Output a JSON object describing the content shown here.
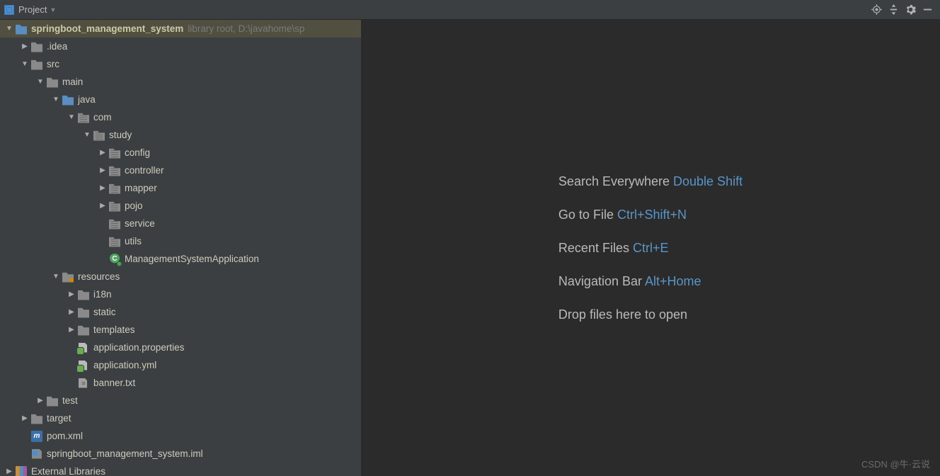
{
  "toolbar": {
    "title": "Project"
  },
  "tree": [
    {
      "indent": 0,
      "arrow": "Expanded",
      "icon": "folder-blue",
      "label": "springboot_management_system",
      "bold": true,
      "suffix": "library root,  D:\\javahome\\sp",
      "selected": true
    },
    {
      "indent": 1,
      "arrow": "Collapsed",
      "icon": "folder",
      "label": ".idea"
    },
    {
      "indent": 1,
      "arrow": "Expanded",
      "icon": "folder",
      "label": "src"
    },
    {
      "indent": 2,
      "arrow": "Expanded",
      "icon": "folder",
      "label": "main"
    },
    {
      "indent": 3,
      "arrow": "Expanded",
      "icon": "folder-blue",
      "label": "java"
    },
    {
      "indent": 4,
      "arrow": "Expanded",
      "icon": "pkg",
      "label": "com"
    },
    {
      "indent": 5,
      "arrow": "Expanded",
      "icon": "pkg",
      "label": "study"
    },
    {
      "indent": 6,
      "arrow": "Collapsed",
      "icon": "pkg",
      "label": "config"
    },
    {
      "indent": 6,
      "arrow": "Collapsed",
      "icon": "pkg",
      "label": "controller"
    },
    {
      "indent": 6,
      "arrow": "Collapsed",
      "icon": "pkg",
      "label": "mapper"
    },
    {
      "indent": 6,
      "arrow": "Collapsed",
      "icon": "pkg",
      "label": "pojo"
    },
    {
      "indent": 6,
      "arrow": "None",
      "icon": "pkg",
      "label": "service"
    },
    {
      "indent": 6,
      "arrow": "None",
      "icon": "pkg",
      "label": "utils"
    },
    {
      "indent": 6,
      "arrow": "None",
      "icon": "java-file",
      "label": "ManagementSystemApplication"
    },
    {
      "indent": 3,
      "arrow": "Expanded",
      "icon": "res-folder",
      "label": "resources"
    },
    {
      "indent": 4,
      "arrow": "Collapsed",
      "icon": "folder",
      "label": "i18n"
    },
    {
      "indent": 4,
      "arrow": "Collapsed",
      "icon": "folder",
      "label": "static"
    },
    {
      "indent": 4,
      "arrow": "Collapsed",
      "icon": "folder",
      "label": "templates"
    },
    {
      "indent": 4,
      "arrow": "None",
      "icon": "prop-file",
      "label": "application.properties"
    },
    {
      "indent": 4,
      "arrow": "None",
      "icon": "yml-file",
      "label": "application.yml"
    },
    {
      "indent": 4,
      "arrow": "None",
      "icon": "txt-file",
      "label": "banner.txt"
    },
    {
      "indent": 2,
      "arrow": "Collapsed",
      "icon": "folder",
      "label": "test"
    },
    {
      "indent": 1,
      "arrow": "Collapsed",
      "icon": "folder",
      "label": "target"
    },
    {
      "indent": 1,
      "arrow": "None",
      "icon": "pom-file",
      "label": "pom.xml"
    },
    {
      "indent": 1,
      "arrow": "None",
      "icon": "iml-file",
      "label": "springboot_management_system.iml"
    },
    {
      "indent": 0,
      "arrow": "Collapsed",
      "icon": "lib-icon",
      "label": "External Libraries"
    }
  ],
  "help": [
    {
      "text": "Search Everywhere",
      "key": "Double Shift"
    },
    {
      "text": "Go to File",
      "key": "Ctrl+Shift+N"
    },
    {
      "text": "Recent Files",
      "key": "Ctrl+E"
    },
    {
      "text": "Navigation Bar",
      "key": "Alt+Home"
    },
    {
      "text": "Drop files here to open",
      "key": ""
    }
  ],
  "watermark": "CSDN @牛·云说"
}
